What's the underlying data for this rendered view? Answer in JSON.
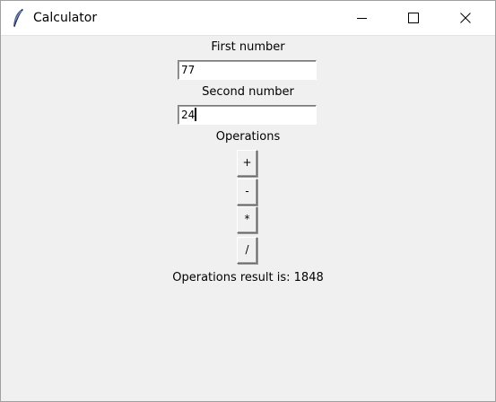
{
  "window": {
    "title": "Calculator"
  },
  "form": {
    "first_label": "First number",
    "first_value": "77",
    "second_label": "Second number",
    "second_value": "24",
    "operations_label": "Operations",
    "buttons": [
      "+",
      "-",
      "*",
      "/"
    ],
    "result_text": "Operations result is: 1848"
  }
}
